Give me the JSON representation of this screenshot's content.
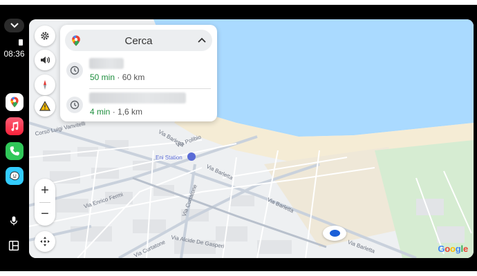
{
  "status": {
    "time": "08:36"
  },
  "dock": {
    "apps": [
      "Google Maps",
      "Music",
      "Phone",
      "Waze"
    ]
  },
  "panel": {
    "search_label": "Cerca",
    "results": [
      {
        "time": "50 min",
        "distance": "· 60 km"
      },
      {
        "time": "4 min",
        "distance": "· 1,6 km"
      }
    ]
  },
  "map": {
    "streets": [
      "Corso Luigi Vanvitelli",
      "Via Barletta",
      "Via Polibio",
      "Eni Station",
      "Via Barletta",
      "Via Enrico Fermi",
      "Via Curtatone",
      "Via Barletta",
      "Via Alcide De Gasperi",
      "Via Barletta",
      "Via Curtatone"
    ],
    "attribution": "Google"
  },
  "colors": {
    "sea": "#aadaff",
    "beach": "#f5ecd5",
    "park": "#d6ecd2",
    "route_time": "#1e8e3e",
    "location": "#1a5fd8"
  }
}
